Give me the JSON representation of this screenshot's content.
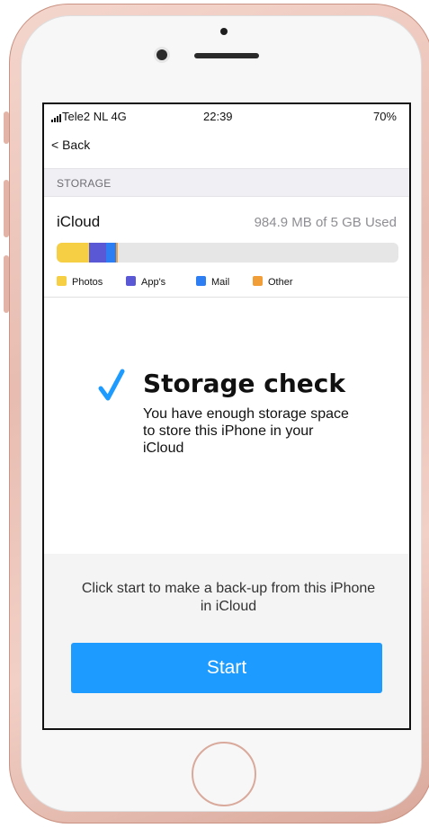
{
  "status_bar": {
    "carrier": "Tele2 NL  4G",
    "time": "22:39",
    "battery": "70%"
  },
  "nav": {
    "back_label": "< Back"
  },
  "storage_section": {
    "header": "STORAGE"
  },
  "icloud": {
    "title": "iCloud",
    "usage": "984.9 MB of 5 GB Used",
    "bar_segments": [
      {
        "name": "Photos",
        "color": "#f7cf44",
        "fraction": 0.095
      },
      {
        "name": "App's",
        "color": "#5b58d6",
        "fraction": 0.05
      },
      {
        "name": "Mail",
        "color": "#2d7ef2",
        "fraction": 0.03
      },
      {
        "name": "Other",
        "color": "#f29e38",
        "fraction": 0.006
      }
    ],
    "legend": [
      {
        "label": "Photos",
        "color": "#f7cf44"
      },
      {
        "label": "App's",
        "color": "#5b58d6"
      },
      {
        "label": "Mail",
        "color": "#2d7ef2"
      },
      {
        "label": "Other",
        "color": "#f29e38"
      }
    ]
  },
  "storage_check": {
    "title": "Storage check",
    "message": "You have enough storage space to store this iPhone in your iCloud",
    "check_color": "#1e9bff"
  },
  "backup": {
    "hint": "Click start to make a back-up from this iPhone in iCloud",
    "start_label": "Start",
    "button_color": "#1e9bff"
  }
}
